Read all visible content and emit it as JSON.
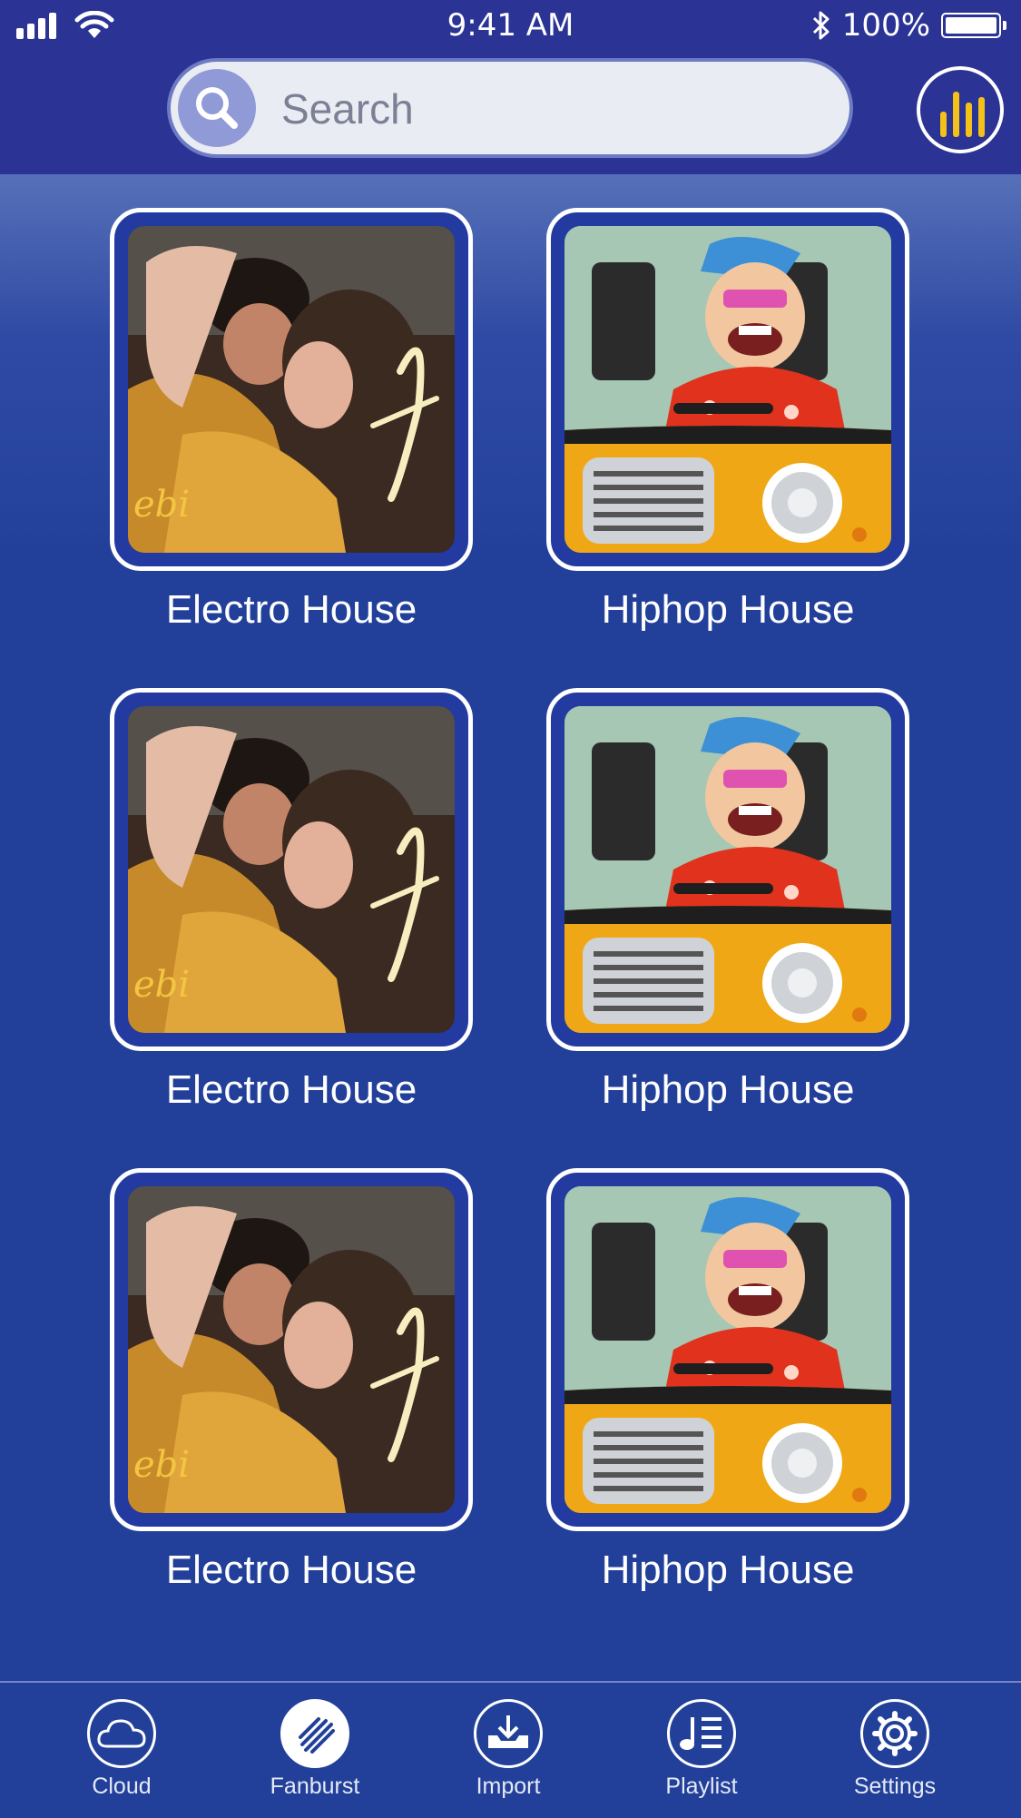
{
  "status_bar": {
    "time": "9:41 AM",
    "battery": "100%"
  },
  "search": {
    "placeholder": "Search"
  },
  "grid": {
    "tiles": [
      {
        "label": "Electro House",
        "art": "romantic-couple-poster"
      },
      {
        "label": "Hiphop House",
        "art": "cartoon-driver-yellow-car"
      },
      {
        "label": "Electro House",
        "art": "romantic-couple-poster"
      },
      {
        "label": "Hiphop House",
        "art": "cartoon-driver-yellow-car"
      },
      {
        "label": "Electro House",
        "art": "romantic-couple-poster"
      },
      {
        "label": "Hiphop House",
        "art": "cartoon-driver-yellow-car"
      }
    ]
  },
  "tabbar": {
    "items": [
      {
        "label": "Cloud",
        "icon": "cloud-icon"
      },
      {
        "label": "Fanburst",
        "icon": "fanburst-icon",
        "active": true
      },
      {
        "label": "Import",
        "icon": "import-icon"
      },
      {
        "label": "Playlist",
        "icon": "playlist-icon"
      },
      {
        "label": "Settings",
        "icon": "settings-icon"
      }
    ]
  },
  "colors": {
    "header_bg": "#2b3394",
    "content_bg": "#22409a",
    "accent_yellow": "#f3c11a"
  }
}
